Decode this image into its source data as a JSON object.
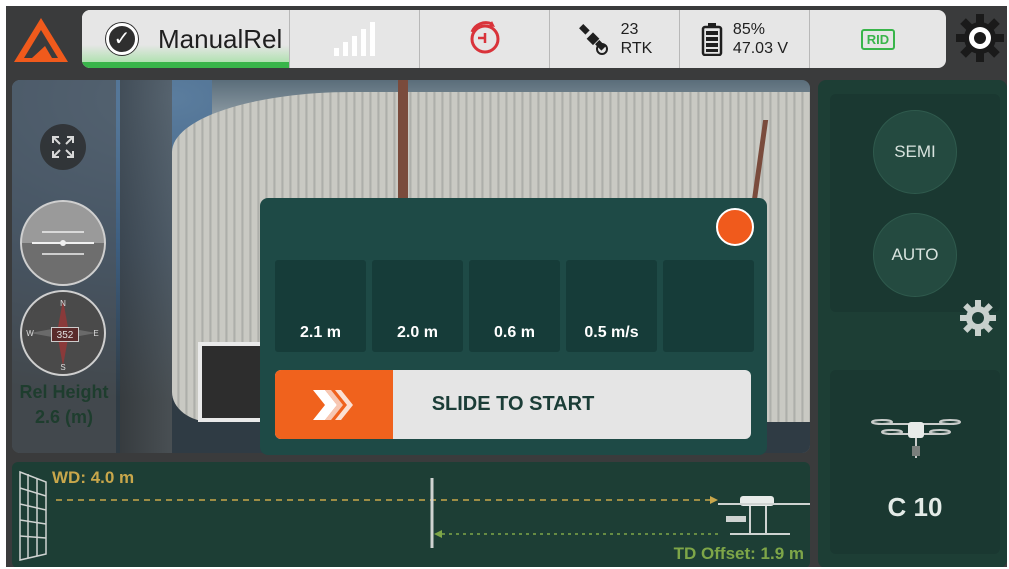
{
  "topbar": {
    "mode": "ManualRel",
    "signal_bars": 5,
    "gps": {
      "satellites": "23",
      "fix": "RTK"
    },
    "battery": {
      "percent": "85%",
      "voltage": "47.03 V"
    },
    "rid": "RID"
  },
  "camera": {
    "compass_heading": "352",
    "rel_height_label": "Rel Height",
    "rel_height_value": "2.6 (m)"
  },
  "dialog": {
    "metrics": [
      "2.1 m",
      "2.0 m",
      "0.6 m",
      "0.5 m/s",
      ""
    ],
    "slide_label": "SLIDE TO START"
  },
  "right_panel": {
    "semi_label": "SEMI",
    "auto_label": "AUTO",
    "aircraft_label": "C 10"
  },
  "bottom_panel": {
    "wd_label": "WD: 4.0 m",
    "td_offset_label": "TD Offset: 1.9 m"
  },
  "colors": {
    "accent_orange": "#f0621d",
    "panel_green": "#1d3e35",
    "status_green": "#39b54a"
  }
}
